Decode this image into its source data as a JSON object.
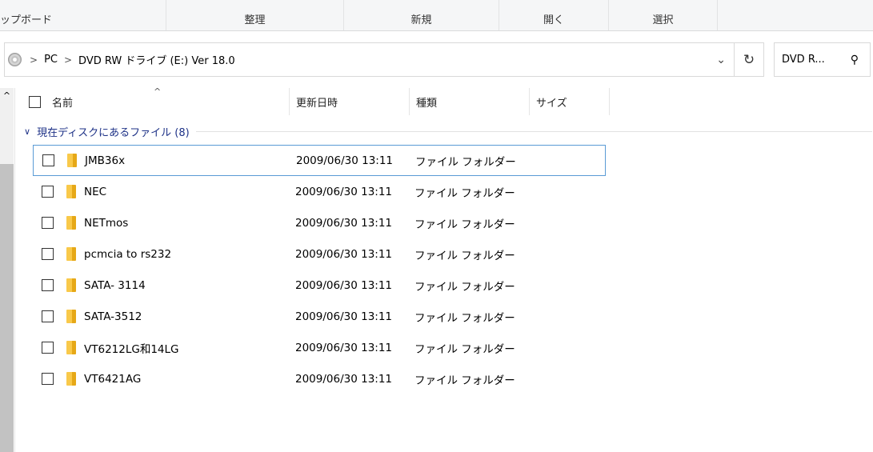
{
  "ribbon": {
    "groups": [
      "ップボード",
      "整理",
      "新規",
      "開く",
      "選択"
    ]
  },
  "address": {
    "crumbs": [
      "PC",
      "DVD RW ドライブ (E:) Ver 18.0"
    ],
    "search_placeholder": "DVD R...",
    "refresh_icon": "↻",
    "dropdown_icon": "⌄"
  },
  "columns": {
    "name": "名前",
    "date": "更新日時",
    "type": "種類",
    "size": "サイズ"
  },
  "group": {
    "label": "現在ディスクにあるファイル (8)"
  },
  "files": [
    {
      "name": "JMB36x",
      "date": "2009/06/30 13:11",
      "type": "ファイル フォルダー"
    },
    {
      "name": "NEC",
      "date": "2009/06/30 13:11",
      "type": "ファイル フォルダー"
    },
    {
      "name": "NETmos",
      "date": "2009/06/30 13:11",
      "type": "ファイル フォルダー"
    },
    {
      "name": "pcmcia to rs232",
      "date": "2009/06/30 13:11",
      "type": "ファイル フォルダー"
    },
    {
      "name": "SATA- 3114",
      "date": "2009/06/30 13:11",
      "type": "ファイル フォルダー"
    },
    {
      "name": "SATA-3512",
      "date": "2009/06/30 13:11",
      "type": "ファイル フォルダー"
    },
    {
      "name": "VT6212LG和14LG",
      "date": "2009/06/30 13:11",
      "type": "ファイル フォルダー"
    },
    {
      "name": "VT6421AG",
      "date": "2009/06/30 13:11",
      "type": "ファイル フォルダー"
    }
  ]
}
